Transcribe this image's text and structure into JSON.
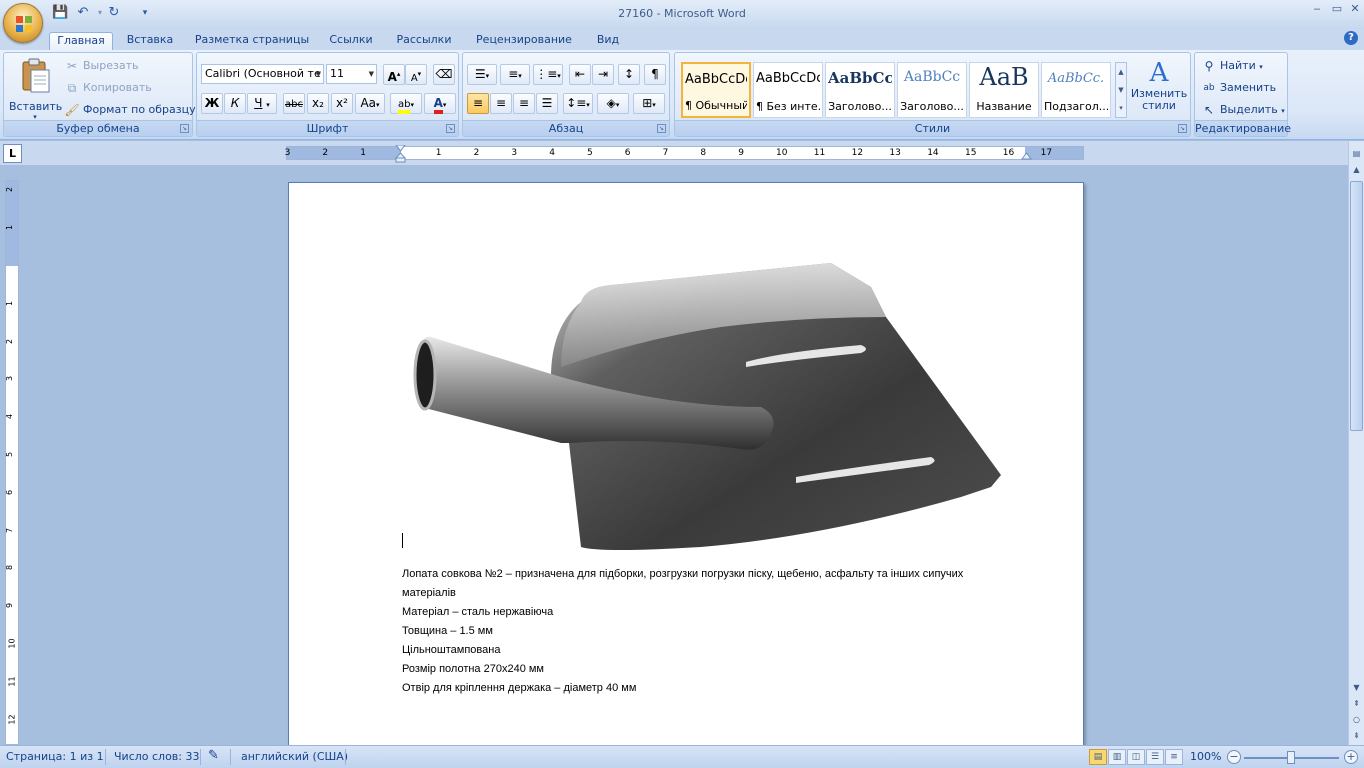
{
  "window": {
    "title": "27160 - Microsoft Word",
    "minimize": "‒",
    "maximize": "▭",
    "close": "✕"
  },
  "tabs": [
    "Главная",
    "Вставка",
    "Разметка страницы",
    "Ссылки",
    "Рассылки",
    "Рецензирование",
    "Вид"
  ],
  "ribbon": {
    "clipboard": {
      "label": "Буфер обмена",
      "paste": "Вставить",
      "cut": "Вырезать",
      "copy": "Копировать",
      "format_painter": "Формат по образцу"
    },
    "font": {
      "label": "Шрифт",
      "font_name": "Calibri (Основной те",
      "font_size": "11",
      "bold": "Ж",
      "italic": "К",
      "underline": "Ч",
      "strike": "abc",
      "subscript": "x₂",
      "superscript": "x²",
      "change_case": "Аа"
    },
    "paragraph": {
      "label": "Абзац"
    },
    "styles": {
      "label": "Стили",
      "items": [
        {
          "sample": "AaBbCcDc",
          "name": "¶ Обычный"
        },
        {
          "sample": "AaBbCcDc",
          "name": "¶ Без инте..."
        },
        {
          "sample": "AaBbCc",
          "name": "Заголово..."
        },
        {
          "sample": "AaBbCc",
          "name": "Заголово..."
        },
        {
          "sample": "AaB",
          "name": "Название"
        },
        {
          "sample": "AaBbCc.",
          "name": "Подзагол..."
        }
      ],
      "change_styles_1": "Изменить",
      "change_styles_2": "стили"
    },
    "editing": {
      "label": "Редактирование",
      "find": "Найти",
      "replace": "Заменить",
      "select": "Выделить"
    }
  },
  "ruler": {
    "corner": "L",
    "h_numbers": [
      "3",
      "2",
      "1",
      "1",
      "2",
      "3",
      "4",
      "5",
      "6",
      "7",
      "8",
      "9",
      "10",
      "11",
      "12",
      "13",
      "14",
      "15",
      "16",
      "17"
    ],
    "v_numbers": [
      "2",
      "1",
      "1",
      "2",
      "3",
      "4",
      "5",
      "6",
      "7",
      "8",
      "9",
      "10",
      "11",
      "12"
    ]
  },
  "document": {
    "paragraphs": [
      "Лопата совкова №2 – призначена для  підборки, розгрузки погрузки піску, щебеню,  асфальту та інших сипучих матеріалів",
      "Матеріал – сталь нержавіюча",
      "Товщина – 1.5 мм",
      "Цільноштампована",
      "Розмір полотна 270x240 мм",
      "Отвір для кріплення держака – діаметр 40 мм"
    ]
  },
  "status": {
    "page": "Страница: 1 из 1",
    "words": "Число слов: 33",
    "language": "английский (США)",
    "zoom": "100%"
  },
  "colors": {
    "accent": "#15428b",
    "ribbon_bg": "#dbe7f7",
    "doc_bg": "#a7bfdf"
  }
}
